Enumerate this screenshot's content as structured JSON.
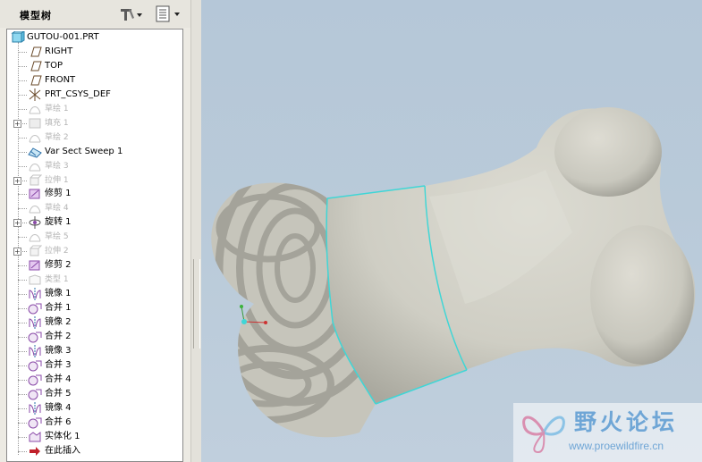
{
  "model_tree": {
    "title": "模型树",
    "settings_menu": "settings",
    "show_menu": "show",
    "items": [
      {
        "label": "GUTOU-001.PRT",
        "icon": "part-icon",
        "dim": false,
        "expander": false
      },
      {
        "label": "RIGHT",
        "icon": "datum-plane-icon",
        "dim": false,
        "expander": false
      },
      {
        "label": "TOP",
        "icon": "datum-plane-icon",
        "dim": false,
        "expander": false
      },
      {
        "label": "FRONT",
        "icon": "datum-plane-icon",
        "dim": false,
        "expander": false
      },
      {
        "label": "PRT_CSYS_DEF",
        "icon": "csys-icon",
        "dim": false,
        "expander": false
      },
      {
        "label": "草绘 1",
        "icon": "sketch-icon",
        "dim": true,
        "expander": false
      },
      {
        "label": "填充 1",
        "icon": "fill-icon",
        "dim": true,
        "expander": true
      },
      {
        "label": "草绘 2",
        "icon": "sketch-icon",
        "dim": true,
        "expander": false
      },
      {
        "label": "Var Sect Sweep 1",
        "icon": "sweep-icon",
        "dim": false,
        "expander": false
      },
      {
        "label": "草绘 3",
        "icon": "sketch-icon",
        "dim": true,
        "expander": false
      },
      {
        "label": "拉伸 1",
        "icon": "extrude-icon",
        "dim": true,
        "expander": true
      },
      {
        "label": "修剪 1",
        "icon": "trim-icon",
        "dim": false,
        "expander": false
      },
      {
        "label": "草绘 4",
        "icon": "sketch-icon",
        "dim": true,
        "expander": false
      },
      {
        "label": "旋转 1",
        "icon": "revolve-icon",
        "dim": false,
        "expander": true
      },
      {
        "label": "草绘 5",
        "icon": "sketch-icon",
        "dim": true,
        "expander": false
      },
      {
        "label": "拉伸 2",
        "icon": "extrude-icon",
        "dim": true,
        "expander": true
      },
      {
        "label": "修剪 2",
        "icon": "trim-icon",
        "dim": false,
        "expander": false
      },
      {
        "label": "类型 1",
        "icon": "type-icon",
        "dim": true,
        "expander": false
      },
      {
        "label": "镜像 1",
        "icon": "mirror-icon",
        "dim": false,
        "expander": false
      },
      {
        "label": "合并 1",
        "icon": "merge-icon",
        "dim": false,
        "expander": false
      },
      {
        "label": "镜像 2",
        "icon": "mirror-icon",
        "dim": false,
        "expander": false
      },
      {
        "label": "合并 2",
        "icon": "merge-icon",
        "dim": false,
        "expander": false
      },
      {
        "label": "镜像 3",
        "icon": "mirror-icon",
        "dim": false,
        "expander": false
      },
      {
        "label": "合并 3",
        "icon": "merge-icon",
        "dim": false,
        "expander": false
      },
      {
        "label": "合并 4",
        "icon": "merge-icon",
        "dim": false,
        "expander": false
      },
      {
        "label": "合并 5",
        "icon": "merge-icon",
        "dim": false,
        "expander": false
      },
      {
        "label": "镜像 4",
        "icon": "mirror-icon",
        "dim": false,
        "expander": false
      },
      {
        "label": "合并 6",
        "icon": "merge-icon",
        "dim": false,
        "expander": false
      },
      {
        "label": "实体化 1",
        "icon": "solidify-icon",
        "dim": false,
        "expander": false
      },
      {
        "label": "在此插入",
        "icon": "insert-here-icon",
        "dim": false,
        "expander": false
      }
    ]
  },
  "viewport": {
    "background_top": "#b5c7d8",
    "background_bottom": "#c0cfdd",
    "model_color": "#cfcec4",
    "edge_highlight_color": "#3fd6d6"
  },
  "watermark": {
    "title": "野火论坛",
    "url": "www.proewildfire.cn"
  }
}
